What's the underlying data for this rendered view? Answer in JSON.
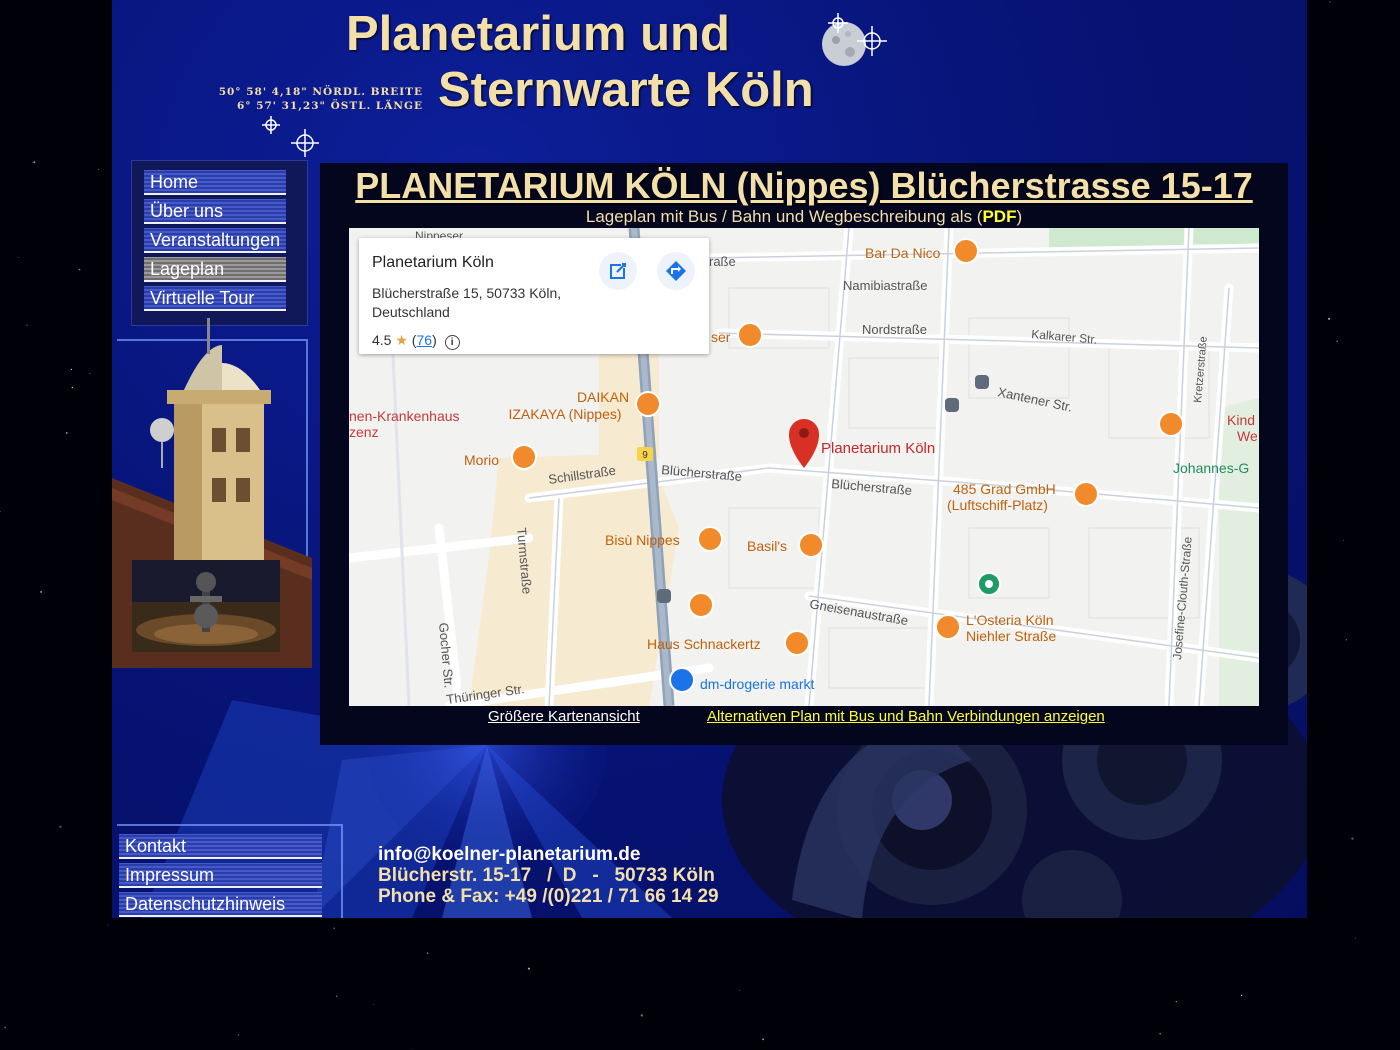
{
  "header": {
    "title_line1": "Planetarium und",
    "title_line2": "Sternwarte Köln",
    "latitude": "50° 58' 4,18\" NÖRDL. BREITE",
    "longitude": "6° 57' 31,23\" ÖSTL. LÄNGE"
  },
  "nav": {
    "items": [
      {
        "label": "Home"
      },
      {
        "label": "Über uns"
      },
      {
        "label": "Veranstaltungen"
      },
      {
        "label": "Lageplan",
        "active": true
      },
      {
        "label": "Virtuelle Tour"
      }
    ]
  },
  "content": {
    "heading": "PLANETARIUM KÖLN (Nippes) Blücherstrasse 15-17",
    "sub_text": "Lageplan mit Bus / Bahn und Wegbeschreibung als (",
    "pdf_label": "PDF",
    "sub_close": ")",
    "link_larger": "Größere Kartenansicht",
    "link_alternative": "Alternativen Plan mit Bus und Bahn Verbindungen anzeigen"
  },
  "map": {
    "info_card": {
      "name": "Planetarium Köln",
      "address": "Blücherstraße 15, 50733 Köln, Deutschland",
      "rating": "4.5",
      "reviews": "76"
    },
    "streets": {
      "namibia": "Namibiastraße",
      "nord": "Nordstraße",
      "kalkarer": "Kalkarer Str.",
      "xantener": "Xantener Str.",
      "schill": "Schillstraße",
      "bluecher1": "Blücherstraße",
      "bluecher2": "Blücherstraße",
      "turm": "Turmstraße",
      "gocher": "Gocher Str.",
      "gneisenau": "Gneisenaustraße",
      "josefine": "Josefine-Clouth-Straße",
      "kretzer": "Kretzerstraße",
      "thueringer": "Thüringer Str.",
      "partial_strasse": "raße",
      "nippeser": "Nippeser"
    },
    "places": {
      "planetarium": "Planetarium Köln",
      "bar_da_nico": "Bar Da Nico",
      "daikan": "DAIKAN\nIZAKAYA (Nippes)",
      "krankenhaus": "nen-Krankenhaus\nzenz",
      "morio": "Morio",
      "bisu": "Bisù Nippes",
      "basils": "Basil's",
      "grad485": "485 Grad GmbH\n(Luftschiff-Platz)",
      "losteria": "L'Osteria Köln\nNiehler Straße",
      "schnackertz": "Haus Schnackertz",
      "dm": "dm-drogerie markt",
      "johannes": "Johannes-G",
      "kind": "Kind\nWe",
      "ser": "ser",
      "route_badge": "9"
    }
  },
  "footer": {
    "nav": [
      {
        "label": "Kontakt"
      },
      {
        "label": "Impressum"
      },
      {
        "label": "Datenschutzhinweis"
      }
    ],
    "email": "info@koelner-planetarium.de",
    "address": "Blücherstr. 15-17   /  D   -   50733 Köln",
    "phone": "Phone & Fax: +49 /(0)221 / 71 66 14 29"
  },
  "colors": {
    "gold": "#f3dfa9",
    "yellow_link": "#ffff33",
    "page_blue": "#071479",
    "map_pin": "#d93025",
    "map_poi_orange": "#f18a2a"
  }
}
